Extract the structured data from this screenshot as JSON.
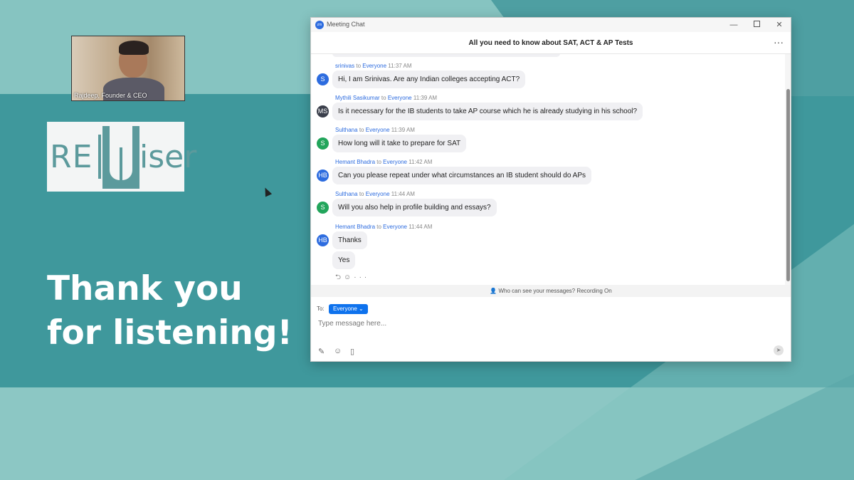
{
  "slide": {
    "speaker_label": "Rajdeep, Founder & CEO",
    "logo_left": "RE",
    "logo_right": "iser",
    "thanks_line1": "Thank you",
    "thanks_line2": "for listening!"
  },
  "window": {
    "title": "Meeting Chat",
    "app_icon": "zoom",
    "minimize_icon": "—",
    "close_icon": "✕"
  },
  "chat": {
    "title": "All you need to know about SAT, ACT & AP Tests",
    "more_icon": "···",
    "messages": [
      {
        "initials": "S",
        "avatar_color": "#2d6cdf",
        "sender": "srinivas",
        "to": "to",
        "recipient": "Everyone",
        "time": "11:37 AM",
        "texts": [
          "Hi, I am Srinivas. Are any Indian colleges accepting ACT?"
        ]
      },
      {
        "initials": "MS",
        "avatar_color": "#3a3f4b",
        "sender": "Mythili Sasikumar",
        "to": "to",
        "recipient": "Everyone",
        "time": "11:39 AM",
        "texts": [
          "Is it necessary for the IB students to take AP course which he is already studying in his school?"
        ]
      },
      {
        "initials": "S",
        "avatar_color": "#22a55b",
        "sender": "Sulthana",
        "to": "to",
        "recipient": "Everyone",
        "time": "11:39 AM",
        "texts": [
          "How long will it take to prepare for SAT"
        ]
      },
      {
        "initials": "HB",
        "avatar_color": "#2d6cdf",
        "sender": "Hemant Bhadra",
        "to": "to",
        "recipient": "Everyone",
        "time": "11:42 AM",
        "texts": [
          "Can you please repeat under what circumstances an IB student should do APs"
        ]
      },
      {
        "initials": "S",
        "avatar_color": "#22a55b",
        "sender": "Sulthana",
        "to": "to",
        "recipient": "Everyone",
        "time": "11:44 AM",
        "texts": [
          "Will you also help in profile building and essays?"
        ]
      },
      {
        "initials": "HB",
        "avatar_color": "#2d6cdf",
        "sender": "Hemant Bhadra",
        "to": "to",
        "recipient": "Everyone",
        "time": "11:44 AM",
        "texts": [
          "Thanks",
          "Yes"
        ]
      }
    ],
    "notice": "Who can see your messages? Recording On"
  },
  "compose": {
    "to_label": "To:",
    "recipient": "Everyone ⌄",
    "placeholder": "Type message here..."
  }
}
